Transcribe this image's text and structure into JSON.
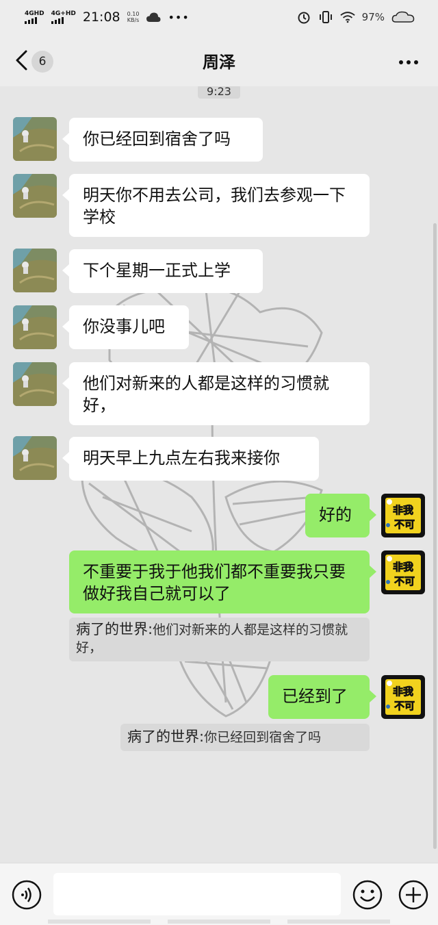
{
  "status_bar": {
    "signal1": "4GHD",
    "signal2": "4G+HD",
    "time": "21:08",
    "net_speed_value": "0.10",
    "net_speed_unit": "KB/s",
    "battery": "97%"
  },
  "header": {
    "back_badge": "6",
    "title": "周泽"
  },
  "chat": {
    "time_divider": "9:23",
    "incoming": [
      "你已经回到宿舍了吗",
      "明天你不用去公司，我们去参观一下学校",
      "下个星期一正式上学",
      "你没事儿吧",
      "他们对新来的人都是这样的习惯就好，",
      "明天早上九点左右我来接你"
    ],
    "outgoing": [
      "好的",
      "不重要于我于他我们都不重要我只要做好我自己就可以了",
      "已经到了"
    ],
    "quotes": [
      {
        "sender": "病了的世界:",
        "text": "他们对新来的人都是这样的习惯就好，"
      },
      {
        "sender": "病了的世界:",
        "text": "你已经回到宿舍了吗"
      }
    ],
    "my_avatar_text": [
      "非我",
      "不可"
    ]
  },
  "input_bar": {
    "placeholder": ""
  },
  "colors": {
    "outgoing_bubble": "#95ec69",
    "incoming_bubble": "#ffffff",
    "background": "#e6e6e6"
  }
}
